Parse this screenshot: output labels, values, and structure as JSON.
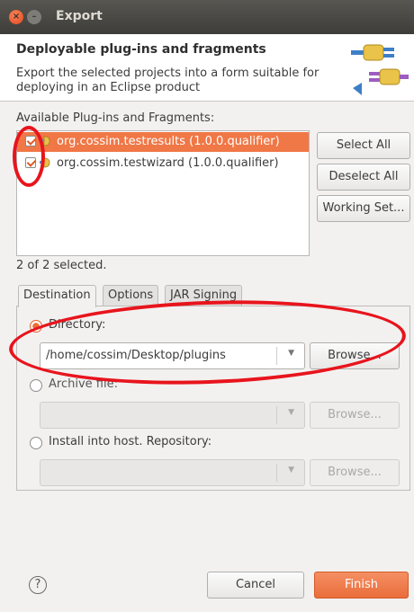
{
  "window": {
    "title": "Export"
  },
  "header": {
    "title": "Deployable plug-ins and fragments",
    "description": "Export the selected projects into a form suitable for deploying in an Eclipse product"
  },
  "plugins": {
    "label": "Available Plug-ins and Fragments:",
    "items": [
      {
        "name": "org.cossim.testresults (1.0.0.qualifier)",
        "checked": true,
        "selected": true
      },
      {
        "name": "org.cossim.testwizard (1.0.0.qualifier)",
        "checked": true,
        "selected": false
      }
    ],
    "selected_count": "2 of 2 selected."
  },
  "side_buttons": {
    "select_all": "Select All",
    "deselect_all": "Deselect All",
    "working_set": "Working Set..."
  },
  "tabs": [
    "Destination",
    "Options",
    "JAR Signing"
  ],
  "destination": {
    "directory_label": "Directory:",
    "directory_value": "/home/cossim/Desktop/plugins",
    "archive_label": "Archive file:",
    "archive_value": "",
    "install_label": "Install into host. Repository:",
    "install_value": "",
    "browse": "Browse..."
  },
  "footer": {
    "help": "?",
    "cancel": "Cancel",
    "finish": "Finish"
  },
  "colors": {
    "accent": "#f07746",
    "annotation": "#e8141c"
  }
}
